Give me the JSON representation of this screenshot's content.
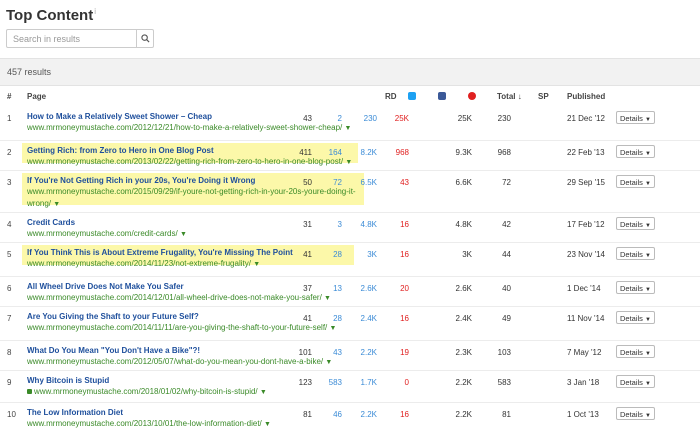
{
  "header": {
    "title": "Top Content",
    "info_mark": "i"
  },
  "search": {
    "placeholder": "Search in results"
  },
  "results_count": "457 results",
  "columns": {
    "num": "#",
    "page": "Page",
    "rd": "RD",
    "total": "Total",
    "total_sort": "↓",
    "sp": "SP",
    "published": "Published"
  },
  "details_label": "Details",
  "colors": {
    "twitter": "#1da1f2",
    "facebook": "#3b5998",
    "pinterest": "#e02020",
    "title": "#1e4f9c",
    "url": "#3a8a28",
    "highlight": "#fcf8a9"
  },
  "rows": [
    {
      "num": "1",
      "title": "How to Make a Relatively Sweet Shower – Cheap",
      "url": [
        "www.mrmoneymustache.com/2012/12/21/how-to-make-a-relatively-sweet-shower-cheap/"
      ],
      "rd": "43",
      "tw": "2",
      "fb": "230",
      "pin": "25K",
      "total": "25K",
      "sp": "230",
      "published": "21 Dec '12",
      "highlight": false
    },
    {
      "num": "2",
      "title": "Getting Rich: from Zero to Hero in One Blog Post",
      "url": [
        "www.mrmoneymustache.com/2013/02/22/getting-rich-from-zero-to-hero-in-one-blog-post/"
      ],
      "rd": "411",
      "tw": "164",
      "fb": "8.2K",
      "pin": "968",
      "total": "9.3K",
      "sp": "968",
      "published": "22 Feb '13",
      "highlight": true
    },
    {
      "num": "3",
      "title": "If You're Not Getting Rich in your 20s, You're Doing it Wrong",
      "url": [
        "www.mrmoneymustache.com/2015/09/29/if-youre-not-getting-rich-in-your-20s-youre-doing-it-",
        "wrong/"
      ],
      "rd": "50",
      "tw": "72",
      "fb": "6.5K",
      "pin": "43",
      "total": "6.6K",
      "sp": "72",
      "published": "29 Sep '15",
      "highlight": true
    },
    {
      "num": "4",
      "title": "Credit Cards",
      "url": [
        "www.mrmoneymustache.com/credit-cards/"
      ],
      "rd": "31",
      "tw": "3",
      "fb": "4.8K",
      "pin": "16",
      "total": "4.8K",
      "sp": "42",
      "published": "17 Feb '12",
      "highlight": false
    },
    {
      "num": "5",
      "title": "If You Think This is About Extreme Frugality, You're Missing The Point",
      "url": [
        "www.mrmoneymustache.com/2014/11/23/not-extreme-frugality/"
      ],
      "rd": "41",
      "tw": "28",
      "fb": "3K",
      "pin": "16",
      "total": "3K",
      "sp": "44",
      "published": "23 Nov '14",
      "highlight": true
    },
    {
      "num": "6",
      "title": "All Wheel Drive Does Not Make You Safer",
      "url": [
        "www.mrmoneymustache.com/2014/12/01/all-wheel-drive-does-not-make-you-safer/"
      ],
      "rd": "37",
      "tw": "13",
      "fb": "2.6K",
      "pin": "20",
      "total": "2.6K",
      "sp": "40",
      "published": "1 Dec '14",
      "highlight": false
    },
    {
      "num": "7",
      "title": "Are You Giving the Shaft to your Future Self?",
      "url": [
        "www.mrmoneymustache.com/2014/11/11/are-you-giving-the-shaft-to-your-future-self/"
      ],
      "rd": "41",
      "tw": "28",
      "fb": "2.4K",
      "pin": "16",
      "total": "2.4K",
      "sp": "49",
      "published": "11 Nov '14",
      "highlight": false
    },
    {
      "num": "8",
      "title": "What Do You Mean \"You Don't Have a Bike\"?!",
      "url": [
        "www.mrmoneymustache.com/2012/05/07/what-do-you-mean-you-dont-have-a-bike/"
      ],
      "rd": "101",
      "tw": "43",
      "fb": "2.2K",
      "pin": "19",
      "total": "2.3K",
      "sp": "103",
      "published": "7 May '12",
      "highlight": false
    },
    {
      "num": "9",
      "title": "Why Bitcoin is Stupid",
      "url": [
        "www.mrmoneymustache.com/2018/01/02/why-bitcoin-is-stupid/"
      ],
      "rd": "123",
      "tw": "583",
      "fb": "1.7K",
      "pin": "0",
      "total": "2.2K",
      "sp": "583",
      "published": "3 Jan '18",
      "highlight": false,
      "lock": true
    },
    {
      "num": "10",
      "title": "The Low Information Diet",
      "url": [
        "www.mrmoneymustache.com/2013/10/01/the-low-information-diet/"
      ],
      "rd": "81",
      "tw": "46",
      "fb": "2.2K",
      "pin": "16",
      "total": "2.2K",
      "sp": "81",
      "published": "1 Oct '13",
      "highlight": false
    }
  ]
}
